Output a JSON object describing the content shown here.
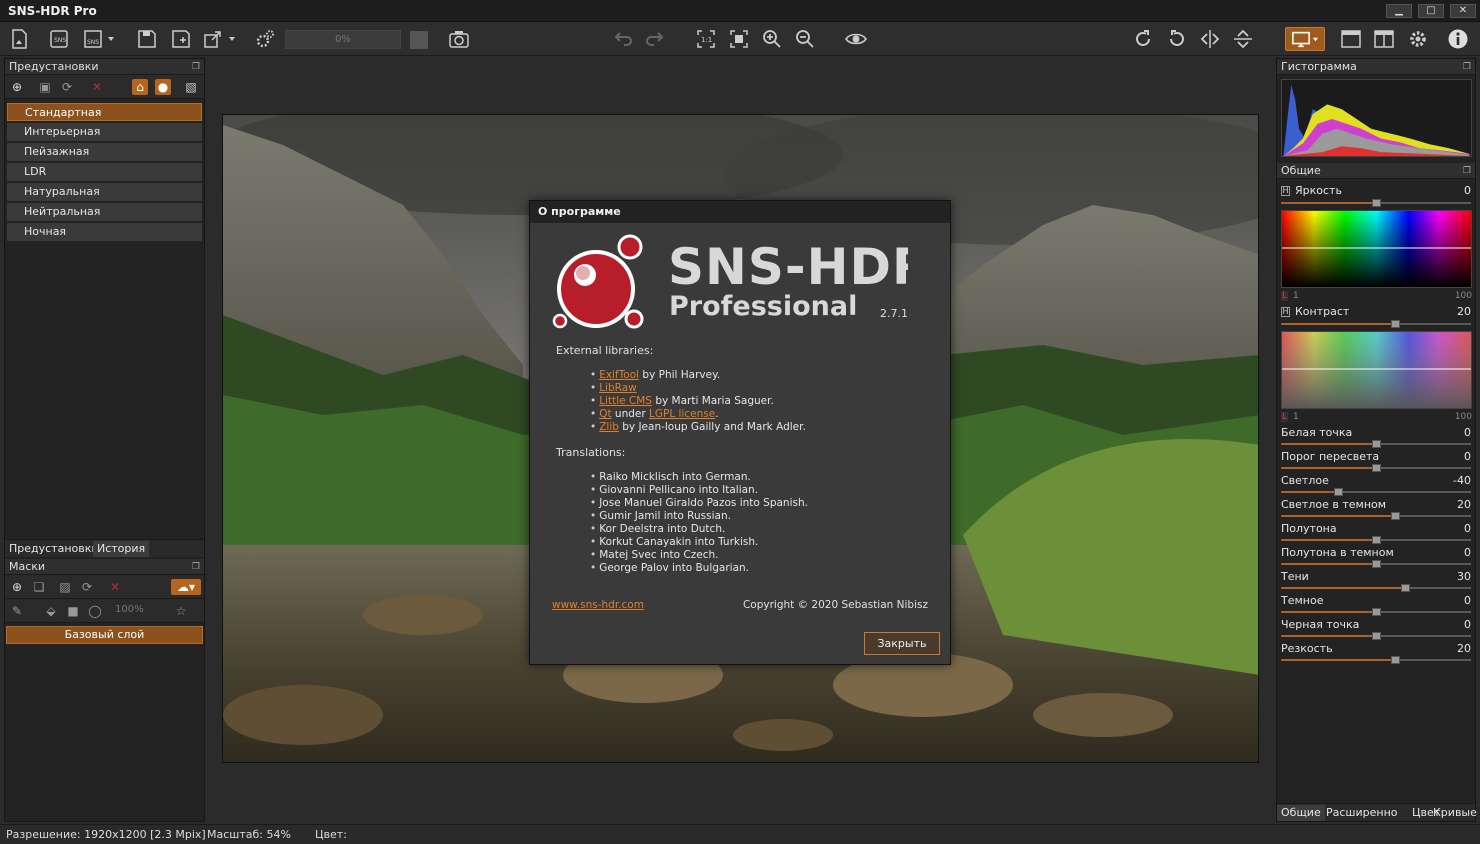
{
  "window": {
    "title": "SNS-HDR Pro"
  },
  "toolbar": {
    "progress": "0%"
  },
  "left": {
    "presets_header": "Предустановки",
    "presets": [
      "Стандартная",
      "Интерьерная",
      "Пейзажная",
      "LDR",
      "Натуральная",
      "Нейтральная",
      "Ночная"
    ],
    "tabs": [
      "Предустановки",
      "История"
    ],
    "masks_header": "Маски",
    "masks_zoom": "100%",
    "base_layer": "Базовый слой"
  },
  "dialog": {
    "title": "О программе",
    "brand_line1": "SNS-HDR",
    "brand_line2": "Professional",
    "version": "2.7.1",
    "ext_title": "External libraries:",
    "ext_libs": [
      {
        "link": "ExifTool",
        "rest": " by Phil Harvey."
      },
      {
        "link": "LibRaw",
        "rest": ""
      },
      {
        "link": "Little CMS",
        "rest": " by Marti Maria Saguer."
      },
      {
        "link": "Qt",
        "mid": " under ",
        "link2": "LGPL license",
        "rest": "."
      },
      {
        "link": "Zlib",
        "rest": " by Jean-loup Gailly and Mark Adler."
      }
    ],
    "trans_title": "Translations:",
    "translations": [
      "Raiko Micklisch into German.",
      "Giovanni Pellicano into Italian.",
      "Jose Manuel Giraldo Pazos into Spanish.",
      "Gumir Jamil into Russian.",
      "Kor Deelstra into Dutch.",
      "Korkut Canayakin into Turkish.",
      "Matej Svec into Czech.",
      "George Palov into Bulgarian."
    ],
    "website": "www.sns-hdr.com",
    "copyright": "Copyright © 2020 Sebastian Nibisz",
    "close_label": "Закрыть"
  },
  "right": {
    "histogram_header": "Гистограмма",
    "general_header": "Общие",
    "brightness": {
      "label": "Яркость",
      "value": "0"
    },
    "contrast": {
      "label": "Контраст",
      "value": "20"
    },
    "scale_left": "1",
    "scale_right": "100",
    "l_marker": "L",
    "h_marker": "H",
    "controls": [
      {
        "label": "Белая точка",
        "value": "0",
        "pos": 0.5
      },
      {
        "label": "Порог пересвета",
        "value": "0",
        "pos": 0.5
      },
      {
        "label": "Светлое",
        "value": "-40",
        "pos": 0.3
      },
      {
        "label": "Светлое в темном",
        "value": "20",
        "pos": 0.6
      },
      {
        "label": "Полутона",
        "value": "0",
        "pos": 0.5
      },
      {
        "label": "Полутона в темном",
        "value": "0",
        "pos": 0.5
      },
      {
        "label": "Тени",
        "value": "30",
        "pos": 0.65
      },
      {
        "label": "Темное",
        "value": "0",
        "pos": 0.5
      },
      {
        "label": "Черная точка",
        "value": "0",
        "pos": 0.5
      },
      {
        "label": "Резкость",
        "value": "20",
        "pos": 0.6
      }
    ],
    "brightness_pos": 0.5,
    "contrast_pos": 0.6,
    "tabs": [
      "Общие",
      "Расширенно",
      "Цвет",
      "Кривые"
    ]
  },
  "status": {
    "resolution": "Разрешение: 1920x1200 [2.3 Mpix]",
    "zoom": "Масштаб: 54%",
    "color": "Цвет:"
  },
  "colors": {
    "accent": "#b5651d",
    "link": "#e0802c"
  }
}
